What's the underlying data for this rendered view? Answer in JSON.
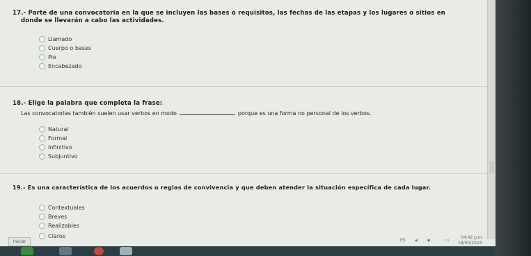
{
  "q17": {
    "title": "17.- Parte de una convocatoria en la que se incluyen las bases o requisitos, las fechas de las etapas y los lugares o sitios en",
    "title2": "donde se llevarán a cabo las actividades.",
    "options": [
      "Llamado",
      "Cuerpo o bases",
      "Pie",
      "Encabezado"
    ]
  },
  "q18": {
    "title": "18.- Elige la palabra que completa la frase:",
    "sentence_before": "Las convocatorias también suelen usar verbos en modo",
    "sentence_after": "porque es una forma no personal de los verbos.",
    "options": [
      "Natural",
      "Formal",
      "Infinitivo",
      "Subjuntivo"
    ]
  },
  "q19": {
    "title": "19.- Es una característica de los acuerdos o reglas de convivencia y que deben atender la situación específica de cada lugar.",
    "options": [
      "Contextuales",
      "Breves",
      "Realizables",
      "Claros"
    ]
  },
  "system": {
    "start_label": "Iniciar",
    "clock": "04:42 p.m.",
    "date": "18/05/2023",
    "lang": "ES"
  }
}
